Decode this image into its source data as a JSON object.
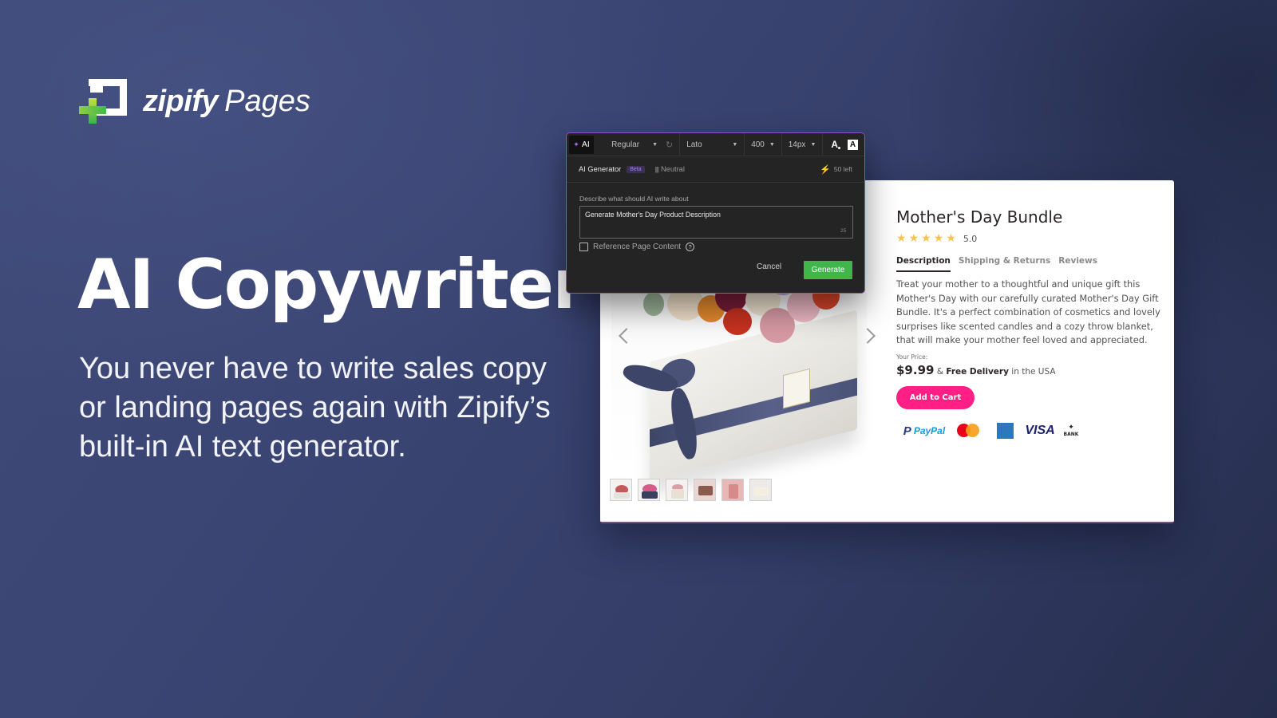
{
  "logo": {
    "brand": "zipify",
    "product": "Pages"
  },
  "hero": {
    "title": "AI Copywriter",
    "subtitle": "You never have to write sales copy or landing pages again with Zipify’s built-in AI text generator."
  },
  "ai_dialog": {
    "toolbar": {
      "ai_label": "AI",
      "style_select": "Regular",
      "font_select": "Lato",
      "weight_select": "400",
      "size_select": "14px",
      "text_color_glyph": "A",
      "text_bg_glyph": "A"
    },
    "generator": {
      "title": "AI Generator",
      "badge": "Beta",
      "tone": "Neutral",
      "credits": "50 left"
    },
    "prompt": {
      "label": "Describe what should AI write about",
      "value": "Generate Mother's Day Product Description",
      "char_count": "25"
    },
    "reference": {
      "label": "Reference Page Content",
      "checked": false,
      "help_glyph": "?"
    },
    "buttons": {
      "cancel": "Cancel",
      "generate": "Generate"
    },
    "colors": {
      "accent_border": "#8a55c9",
      "generate": "#3fb54a",
      "beta": "#a57cf0"
    }
  },
  "product": {
    "title": "Mother's Day Bundle",
    "rating": "5.0",
    "stars": 5,
    "tabs": [
      {
        "label": "Description",
        "active": true
      },
      {
        "label": "Shipping & Returns",
        "active": false
      },
      {
        "label": "Reviews",
        "active": false
      }
    ],
    "description": "Treat your mother to a thoughtful and unique gift this Mother's Day with our carefully curated Mother's Day Gift Bundle. It's a perfect combination of cosmetics and lovely surprises like scented candles and a cozy throw blanket, that will make your mother feel loved and appreciated.",
    "price_label": "Your Price:",
    "price": "$9.99",
    "price_connector": "&",
    "delivery_strong": "Free Delivery",
    "delivery_suffix": "in the USA",
    "add_to_cart": "Add to Cart",
    "payments": {
      "paypal": "PayPal",
      "mastercard": "mastercard",
      "amex": "American Express",
      "visa": "VISA",
      "bank": "BANK"
    },
    "thumbnail_count": 6,
    "colors": {
      "cta": "#ff1f85",
      "star": "#f4c44e"
    }
  }
}
